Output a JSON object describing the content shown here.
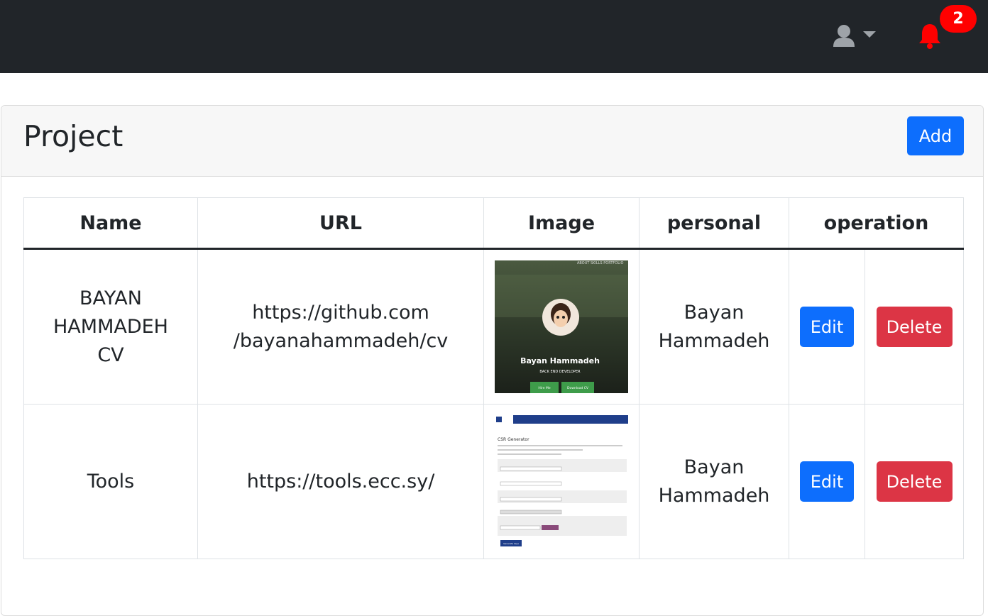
{
  "navbar": {
    "user_icon": "user-icon",
    "dropdown_icon": "caret-down-icon",
    "notification_icon": "bell-icon",
    "notification_count": "2",
    "bell_color": "#ff0000"
  },
  "card": {
    "title": "Project",
    "add_label": "Add"
  },
  "table": {
    "headers": [
      "Name",
      "URL",
      "Image",
      "personal",
      "operation"
    ],
    "rows": [
      {
        "name": "BAYAN HAMMADEH CV",
        "url_line1": "https://github.com",
        "url_line2": "/bayanahammadeh/cv",
        "image_caption": "Bayan Hammadeh",
        "image_subcaption": "BACK END DEVELOPER",
        "image_btn1": "Hire Me",
        "image_btn2": "Download CV",
        "image_nav": "ABOUT   SKILLS   PORTFOLIO",
        "personal_line1": "Bayan",
        "personal_line2": "Hammadeh",
        "edit_label": "Edit",
        "delete_label": "Delete"
      },
      {
        "name": "Tools",
        "url_line1": "https://tools.ecc.sy/",
        "image_heading": "CSR Generator",
        "image_button": "Generate keys",
        "personal_line1": "Bayan",
        "personal_line2": "Hammadeh",
        "edit_label": "Edit",
        "delete_label": "Delete"
      }
    ]
  },
  "colors": {
    "navbar": "#212529",
    "primary": "#0d6efd",
    "danger": "#dc3545",
    "badge": "#ff0000"
  }
}
